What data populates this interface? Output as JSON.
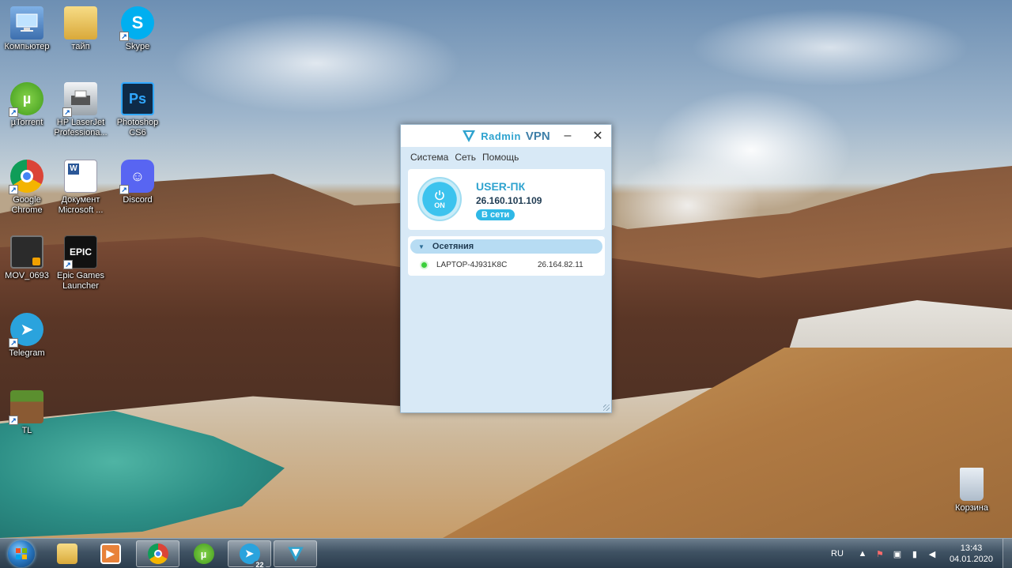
{
  "desktop": {
    "icons": [
      {
        "label": "Компьютер",
        "icon": "computer-icon",
        "color": "#4a7fc0"
      },
      {
        "label": "тайп",
        "icon": "folder-icon",
        "color": "#e8c35a"
      },
      {
        "label": "Skype",
        "icon": "skype-icon",
        "color": "#00aff0"
      },
      {
        "label": "µTorrent",
        "icon": "utorrent-icon",
        "color": "#6cbf2f"
      },
      {
        "label": "HP LaserJet\nProfessiona...",
        "icon": "printer-icon",
        "color": "#cfd5da"
      },
      {
        "label": "Photoshop\nCS6",
        "icon": "photoshop-icon",
        "color": "#0e2a47"
      },
      {
        "label": "Google\nChrome",
        "icon": "chrome-icon",
        "color": "#db4437"
      },
      {
        "label": "Документ\nMicrosoft ...",
        "icon": "word-document-icon",
        "color": "#2b5797"
      },
      {
        "label": "Discord",
        "icon": "discord-icon",
        "color": "#5865f2"
      },
      {
        "label": "MOV_0693",
        "icon": "video-file-icon",
        "color": "#333333"
      },
      {
        "label": "Epic Games\nLauncher",
        "icon": "epic-games-icon",
        "color": "#111111"
      },
      {
        "label": "Telegram",
        "icon": "telegram-icon",
        "color": "#2aa3dd"
      },
      {
        "label": "TL",
        "icon": "minecraft-icon",
        "color": "#5b8f2f"
      },
      {
        "label": "Корзина",
        "icon": "recycle-bin-icon",
        "color": "#c9d6e2"
      }
    ],
    "icon_glyphs": {
      "skype": "S",
      "photoshop": "Ps",
      "epic": "EPIC",
      "discord": "☺",
      "telegram": "➤",
      "utorrent": "µ"
    }
  },
  "vpn": {
    "brand_prefix": "Radmin",
    "brand_suffix": "VPN",
    "menu": [
      "Система",
      "Сеть",
      "Помощь"
    ],
    "power_label": "ON",
    "pc_name": "USER-ПК",
    "pc_ip": "26.160.101.109",
    "pc_status": "В сети",
    "network_name": "Осетяния",
    "peer_name": "LAPTOP-4J931K8C",
    "peer_ip": "26.164.82.11",
    "accent_color": "#2fa3cf",
    "online_color": "#3ccf3c"
  },
  "taskbar": {
    "telegram_badge": "22",
    "language": "RU",
    "time": "13:43",
    "date": "04.01.2020"
  }
}
